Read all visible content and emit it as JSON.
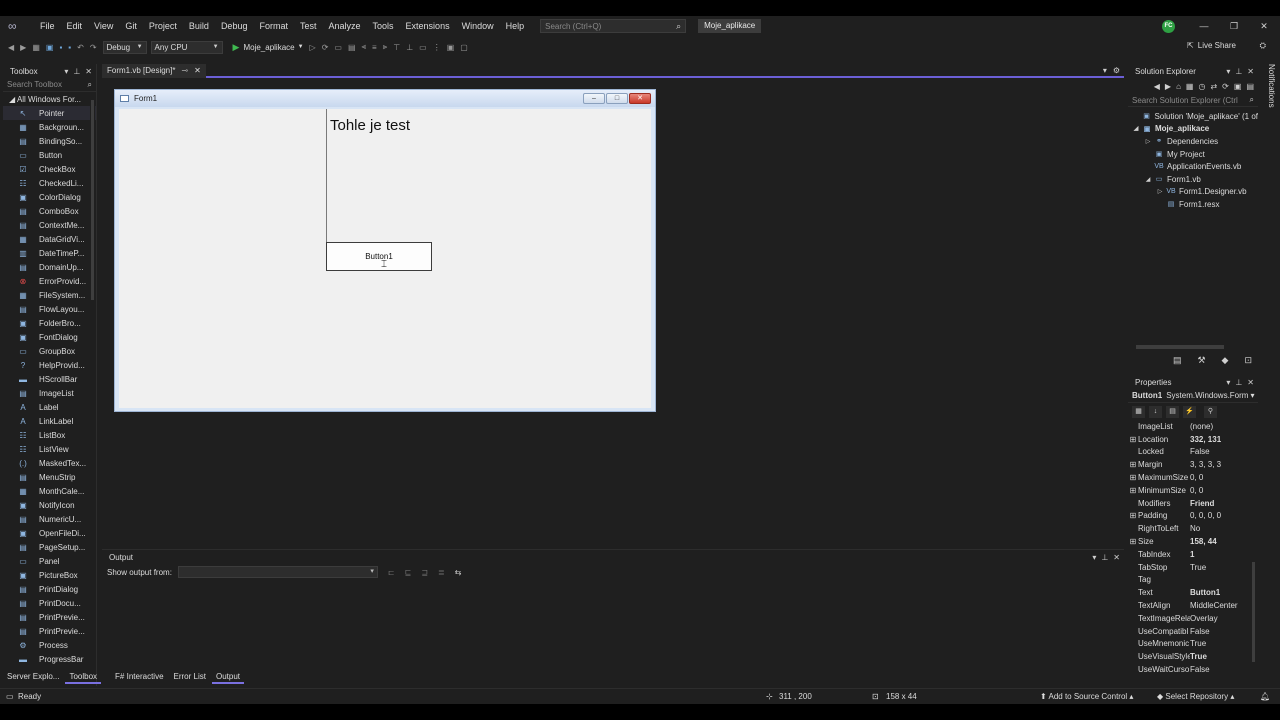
{
  "menubar": {
    "items": [
      "File",
      "Edit",
      "View",
      "Git",
      "Project",
      "Build",
      "Debug",
      "Format",
      "Test",
      "Analyze",
      "Tools",
      "Extensions",
      "Window",
      "Help"
    ],
    "search_placeholder": "Search (Ctrl+Q)",
    "project_name": "Moje_aplikace",
    "avatar_initials": "FC"
  },
  "toolbar": {
    "config": "Debug",
    "platform": "Any CPU",
    "run_target": "Moje_aplikace",
    "live_share": "Live Share"
  },
  "toolbox": {
    "title": "Toolbox",
    "search_placeholder": "Search Toolbox",
    "group": "All Windows For...",
    "items": [
      {
        "label": "Pointer",
        "icon": "pointer-icon",
        "glyph": "↖"
      },
      {
        "label": "Backgroun...",
        "icon": "background-worker-icon",
        "glyph": "▦"
      },
      {
        "label": "BindingSo...",
        "icon": "binding-source-icon",
        "glyph": "▤"
      },
      {
        "label": "Button",
        "icon": "button-icon",
        "glyph": "▭"
      },
      {
        "label": "CheckBox",
        "icon": "checkbox-icon",
        "glyph": "☑"
      },
      {
        "label": "CheckedLi...",
        "icon": "checked-list-box-icon",
        "glyph": "☷"
      },
      {
        "label": "ColorDialog",
        "icon": "color-dialog-icon",
        "glyph": "▣"
      },
      {
        "label": "ComboBox",
        "icon": "combobox-icon",
        "glyph": "▤"
      },
      {
        "label": "ContextMe...",
        "icon": "context-menu-icon",
        "glyph": "▤"
      },
      {
        "label": "DataGridVi...",
        "icon": "datagrid-icon",
        "glyph": "▦"
      },
      {
        "label": "DateTimeP...",
        "icon": "datetime-picker-icon",
        "glyph": "▥"
      },
      {
        "label": "DomainUp...",
        "icon": "domain-updown-icon",
        "glyph": "▤"
      },
      {
        "label": "ErrorProvid...",
        "icon": "error-provider-icon",
        "glyph": "⊗"
      },
      {
        "label": "FileSystem...",
        "icon": "filesystem-watcher-icon",
        "glyph": "▦"
      },
      {
        "label": "FlowLayou...",
        "icon": "flow-layout-icon",
        "glyph": "▤"
      },
      {
        "label": "FolderBro...",
        "icon": "folder-browser-icon",
        "glyph": "▣"
      },
      {
        "label": "FontDialog",
        "icon": "font-dialog-icon",
        "glyph": "▣"
      },
      {
        "label": "GroupBox",
        "icon": "groupbox-icon",
        "glyph": "▭"
      },
      {
        "label": "HelpProvid...",
        "icon": "help-provider-icon",
        "glyph": "?"
      },
      {
        "label": "HScrollBar",
        "icon": "hscrollbar-icon",
        "glyph": "▬"
      },
      {
        "label": "ImageList",
        "icon": "imagelist-icon",
        "glyph": "▤"
      },
      {
        "label": "Label",
        "icon": "label-icon",
        "glyph": "A"
      },
      {
        "label": "LinkLabel",
        "icon": "linklabel-icon",
        "glyph": "A"
      },
      {
        "label": "ListBox",
        "icon": "listbox-icon",
        "glyph": "☷"
      },
      {
        "label": "ListView",
        "icon": "listview-icon",
        "glyph": "☷"
      },
      {
        "label": "MaskedTex...",
        "icon": "masked-textbox-icon",
        "glyph": "(.)"
      },
      {
        "label": "MenuStrip",
        "icon": "menustrip-icon",
        "glyph": "▤"
      },
      {
        "label": "MonthCale...",
        "icon": "month-calendar-icon",
        "glyph": "▦"
      },
      {
        "label": "NotifyIcon",
        "icon": "notify-icon",
        "glyph": "▣"
      },
      {
        "label": "NumericU...",
        "icon": "numeric-updown-icon",
        "glyph": "▤"
      },
      {
        "label": "OpenFileDi...",
        "icon": "open-file-dialog-icon",
        "glyph": "▣"
      },
      {
        "label": "PageSetup...",
        "icon": "page-setup-icon",
        "glyph": "▤"
      },
      {
        "label": "Panel",
        "icon": "panel-icon",
        "glyph": "▭"
      },
      {
        "label": "PictureBox",
        "icon": "picturebox-icon",
        "glyph": "▣"
      },
      {
        "label": "PrintDialog",
        "icon": "print-dialog-icon",
        "glyph": "▤"
      },
      {
        "label": "PrintDocu...",
        "icon": "print-document-icon",
        "glyph": "▤"
      },
      {
        "label": "PrintPrevie...",
        "icon": "print-preview-control-icon",
        "glyph": "▤"
      },
      {
        "label": "PrintPrevie...",
        "icon": "print-preview-dialog-icon",
        "glyph": "▤"
      },
      {
        "label": "Process",
        "icon": "process-icon",
        "glyph": "⚙"
      },
      {
        "label": "ProgressBar",
        "icon": "progressbar-icon",
        "glyph": "▬"
      }
    ]
  },
  "document": {
    "tab_label": "Form1.vb [Design]*"
  },
  "form": {
    "title": "Form1",
    "label_text": "Tohle je test",
    "button_text": "Button1"
  },
  "output": {
    "title": "Output",
    "show_from_label": "Show output from:"
  },
  "bottom_tabs": {
    "left": [
      "Server Explo...",
      "Toolbox"
    ],
    "center": [
      "F# Interactive",
      "Error List",
      "Output"
    ]
  },
  "solution_explorer": {
    "title": "Solution Explorer",
    "search_placeholder": "Search Solution Explorer (Ctrl",
    "tree": [
      {
        "label": "Solution 'Moje_aplikace' (1 of",
        "depth": 0,
        "exp": "",
        "glyph": "▣",
        "bold": false
      },
      {
        "label": "Moje_aplikace",
        "depth": 0,
        "exp": "◢",
        "glyph": "▣",
        "bold": true
      },
      {
        "label": "Dependencies",
        "depth": 1,
        "exp": "▷",
        "glyph": "⚭",
        "bold": false
      },
      {
        "label": "My Project",
        "depth": 1,
        "exp": "",
        "glyph": "▣",
        "bold": false
      },
      {
        "label": "ApplicationEvents.vb",
        "depth": 1,
        "exp": "",
        "glyph": "VB",
        "bold": false
      },
      {
        "label": "Form1.vb",
        "depth": 1,
        "exp": "◢",
        "glyph": "▭",
        "bold": false
      },
      {
        "label": "Form1.Designer.vb",
        "depth": 2,
        "exp": "▷",
        "glyph": "VB",
        "bold": false
      },
      {
        "label": "Form1.resx",
        "depth": 2,
        "exp": "",
        "glyph": "▤",
        "bold": false
      }
    ]
  },
  "properties": {
    "title": "Properties",
    "object_name": "Button1",
    "object_type": "System.Windows.Form",
    "rows": [
      {
        "name": "ImageList",
        "value": "(none)",
        "exp": "",
        "bold": false
      },
      {
        "name": "Location",
        "value": "332, 131",
        "exp": "⊞",
        "bold": true
      },
      {
        "name": "Locked",
        "value": "False",
        "exp": "",
        "bold": false
      },
      {
        "name": "Margin",
        "value": "3, 3, 3, 3",
        "exp": "⊞",
        "bold": false
      },
      {
        "name": "MaximumSize",
        "value": "0, 0",
        "exp": "⊞",
        "bold": false
      },
      {
        "name": "MinimumSize",
        "value": "0, 0",
        "exp": "⊞",
        "bold": false
      },
      {
        "name": "Modifiers",
        "value": "Friend",
        "exp": "",
        "bold": true
      },
      {
        "name": "Padding",
        "value": "0, 0, 0, 0",
        "exp": "⊞",
        "bold": false
      },
      {
        "name": "RightToLeft",
        "value": "No",
        "exp": "",
        "bold": false
      },
      {
        "name": "Size",
        "value": "158, 44",
        "exp": "⊞",
        "bold": true
      },
      {
        "name": "TabIndex",
        "value": "1",
        "exp": "",
        "bold": true
      },
      {
        "name": "TabStop",
        "value": "True",
        "exp": "",
        "bold": false
      },
      {
        "name": "Tag",
        "value": "",
        "exp": "",
        "bold": false
      },
      {
        "name": "Text",
        "value": "Button1",
        "exp": "",
        "bold": true
      },
      {
        "name": "TextAlign",
        "value": "MiddleCenter",
        "exp": "",
        "bold": false
      },
      {
        "name": "TextImageRela",
        "value": "Overlay",
        "exp": "",
        "bold": false
      },
      {
        "name": "UseCompatibl",
        "value": "False",
        "exp": "",
        "bold": false
      },
      {
        "name": "UseMnemonic",
        "value": "True",
        "exp": "",
        "bold": false
      },
      {
        "name": "UseVisualStyle",
        "value": "True",
        "exp": "",
        "bold": true
      },
      {
        "name": "UseWaitCurso",
        "value": "False",
        "exp": "",
        "bold": false
      }
    ]
  },
  "side": {
    "notifications": "Notifications"
  },
  "statusbar": {
    "ready": "Ready",
    "position": "311 , 200",
    "size": "158 x 44",
    "source_control": "Add to Source Control",
    "repository": "Select Repository"
  }
}
